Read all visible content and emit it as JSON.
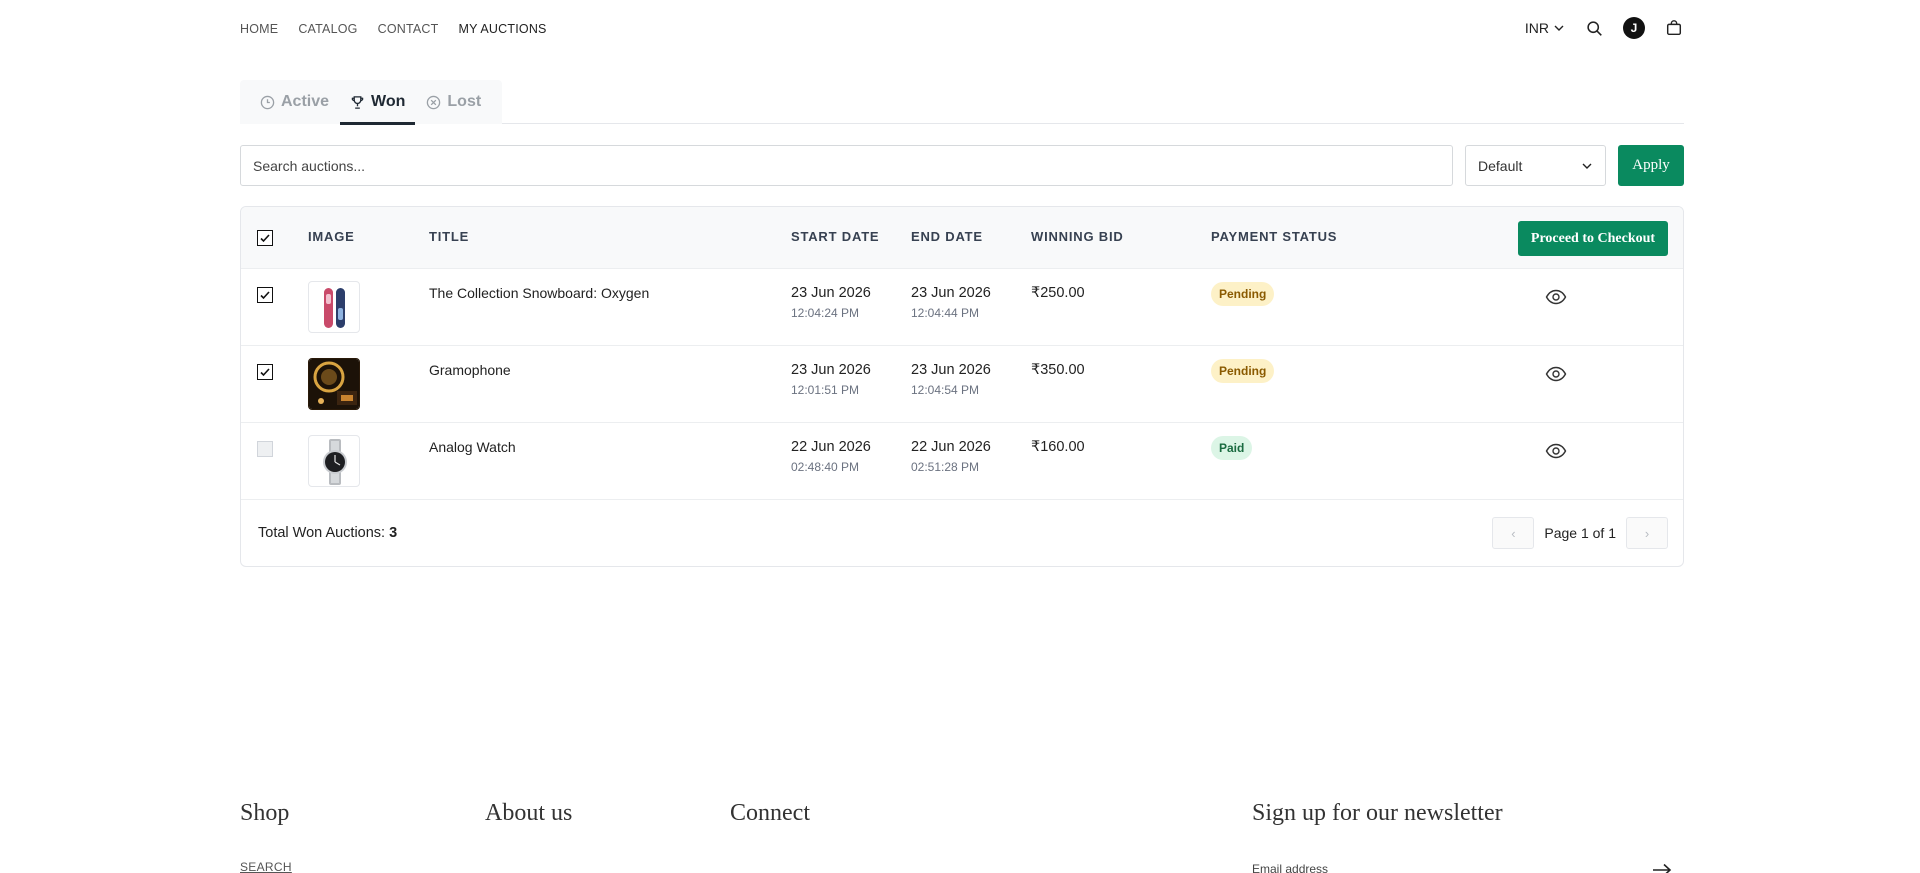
{
  "nav": {
    "items": [
      "HOME",
      "CATALOG",
      "CONTACT",
      "MY AUCTIONS"
    ],
    "currency": "INR",
    "avatar_initial": "J"
  },
  "tabs": [
    {
      "label": "Active",
      "icon": "clock-icon"
    },
    {
      "label": "Won",
      "icon": "trophy-icon",
      "active": true
    },
    {
      "label": "Lost",
      "icon": "x-circle-icon"
    }
  ],
  "search": {
    "placeholder": "Search auctions...",
    "sort_value": "Default",
    "apply_label": "Apply"
  },
  "table": {
    "headers": {
      "image": "IMAGE",
      "title": "TITLE",
      "start": "START DATE",
      "end": "END DATE",
      "bid": "WINNING BID",
      "status": "PAYMENT STATUS"
    },
    "checkout_label": "Proceed to Checkout",
    "rows": [
      {
        "checked": true,
        "title": "The Collection Snowboard: Oxygen",
        "start_date": "23 Jun 2026",
        "start_time": "12:04:24 PM",
        "end_date": "23 Jun 2026",
        "end_time": "12:04:44 PM",
        "bid": "₹250.00",
        "status": "Pending"
      },
      {
        "checked": true,
        "title": "Gramophone",
        "start_date": "23 Jun 2026",
        "start_time": "12:01:51 PM",
        "end_date": "23 Jun 2026",
        "end_time": "12:04:54 PM",
        "bid": "₹350.00",
        "status": "Pending"
      },
      {
        "checked": false,
        "title": "Analog Watch",
        "start_date": "22 Jun 2026",
        "start_time": "02:48:40 PM",
        "end_date": "22 Jun 2026",
        "end_time": "02:51:28 PM",
        "bid": "₹160.00",
        "status": "Paid"
      }
    ],
    "total_label": "Total Won Auctions:",
    "total_count": "3",
    "page_label": "Page 1 of 1",
    "prev_glyph": "‹",
    "next_glyph": "›"
  },
  "footer": {
    "shop": "Shop",
    "about": "About us",
    "connect": "Connect",
    "newsletter": "Sign up for our newsletter",
    "search_link": "SEARCH",
    "email_placeholder": "Email address"
  },
  "colors": {
    "accent": "#0a8a5f",
    "pending_bg": "#fdf1c7",
    "paid_bg": "#dcf5e6"
  }
}
